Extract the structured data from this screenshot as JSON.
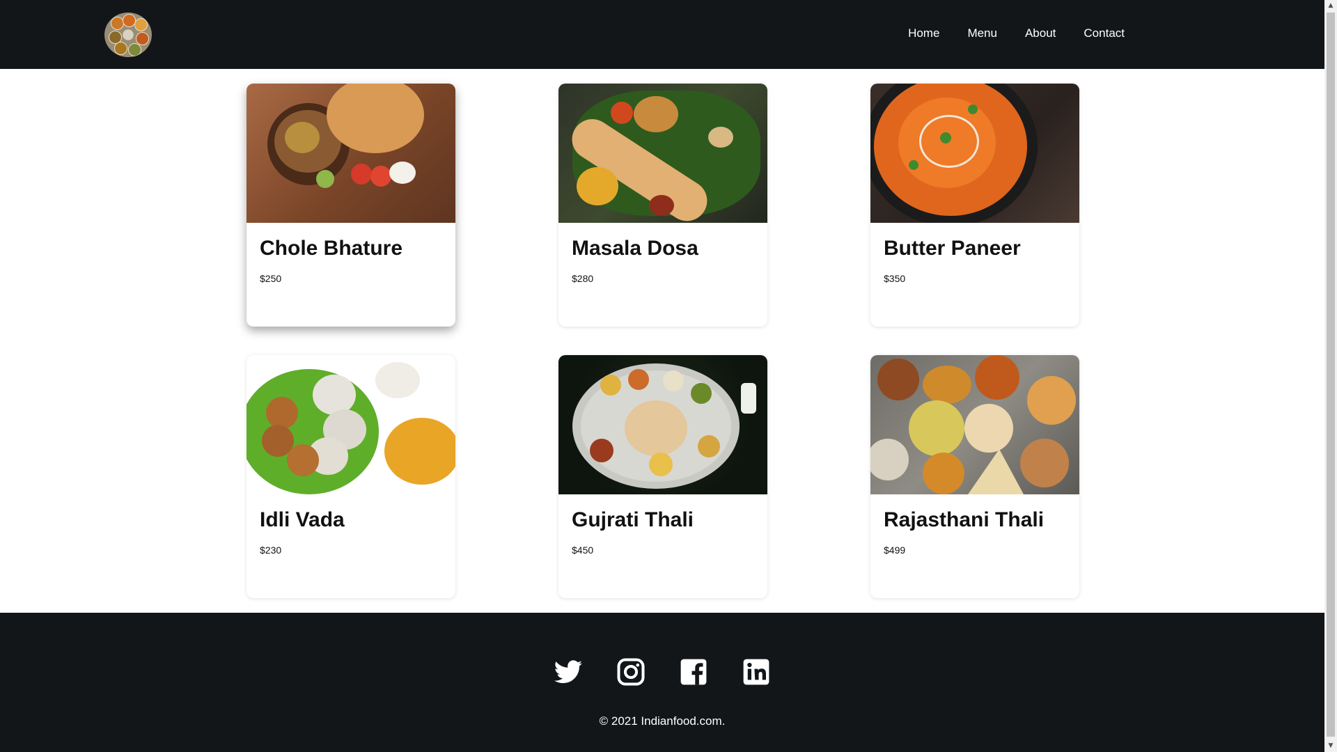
{
  "navbar": {
    "logo_icon": "thali-plate-logo",
    "links": [
      "Home",
      "Menu",
      "About",
      "Contact"
    ]
  },
  "dishes": [
    {
      "name": "Chole Bhature",
      "price": "$250"
    },
    {
      "name": "Masala Dosa",
      "price": "$280"
    },
    {
      "name": "Butter Paneer",
      "price": "$350"
    },
    {
      "name": "Idli Vada",
      "price": "$230"
    },
    {
      "name": "Gujrati Thali",
      "price": "$450"
    },
    {
      "name": "Rajasthani Thali",
      "price": "$499"
    }
  ],
  "footer": {
    "social_icons": [
      "twitter-icon",
      "instagram-icon",
      "facebook-icon",
      "linkedin-icon"
    ],
    "copyright": "© 2021 Indianfood.com."
  },
  "colors": {
    "header_bg": "#121619",
    "footer_bg": "#121619",
    "page_bg": "#ffffff",
    "text": "#111111",
    "nav_text": "#ffffff"
  }
}
